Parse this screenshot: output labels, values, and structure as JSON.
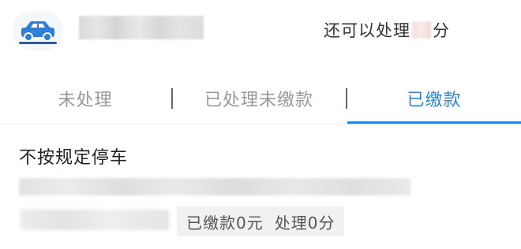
{
  "header": {
    "quota_prefix": "还可以处理",
    "quota_suffix": "分"
  },
  "tabs": [
    {
      "label": "未处理",
      "active": false
    },
    {
      "label": "已处理未缴款",
      "active": false
    },
    {
      "label": "已缴款",
      "active": true
    }
  ],
  "record": {
    "title": "不按规定停车",
    "paid_label": "已缴款0元",
    "points_label": "处理0分"
  },
  "colors": {
    "accent": "#2b87d8",
    "car_icon": "#2f7fd6",
    "inactive_tab": "#999999"
  },
  "icons": {
    "vehicle": "car-icon"
  }
}
